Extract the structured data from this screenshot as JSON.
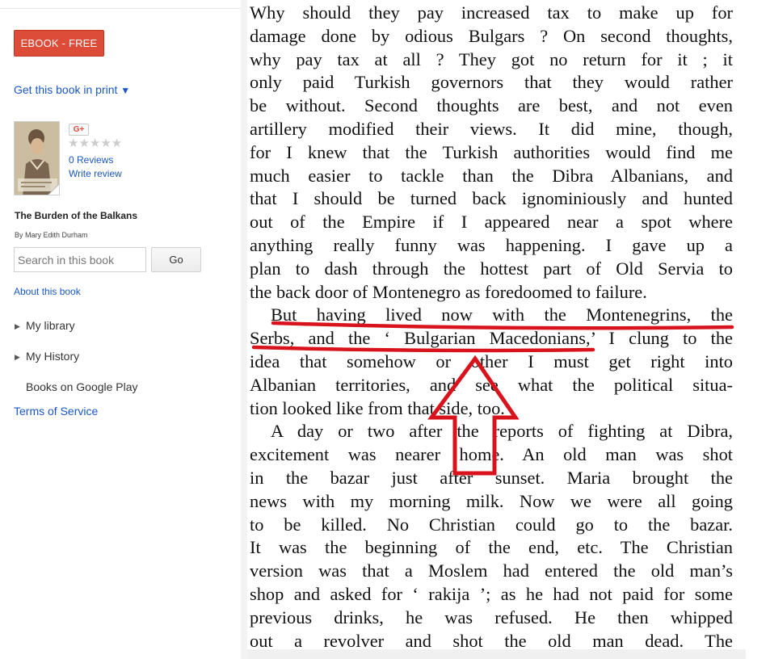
{
  "sidebar": {
    "ebook_button": "EBOOK - FREE",
    "print_link": "Get this book in print",
    "gplus_label": "G+",
    "stars": "★★★★★",
    "reviews_count": "0 Reviews",
    "write_review": "Write review",
    "book_title": "The Burden of the Balkans",
    "author": "By Mary Edith Durham",
    "search_placeholder": "Search in this book",
    "go_button": "Go",
    "about": "About this book",
    "nav": [
      "My library",
      "My History",
      "Books on Google Play"
    ],
    "terms": "Terms of Service"
  },
  "page": {
    "lines": [
      "Why should they pay increased tax to make up for",
      "damage done by odious Bulgars ?  On second thoughts,",
      "why pay tax at all ?  They got no return for it ; it",
      "only paid Turkish governors that they would rather",
      "be without.  Second thoughts are best, and not even",
      "artillery modified their views.  It did mine, though,",
      "for I knew that the Turkish authorities would find me",
      "much easier to tackle than the Dibra Albanians, and",
      "that I should be turned back ignominiously and hunted",
      "out of the Empire if I appeared near a spot where",
      "anything really funny was happening.  I gave up a",
      "plan to dash through the hottest part of Old Servia to",
      "the back door of Montenegro as foredoomed to failure.",
      "But having lived now with the Montenegrins, the",
      "Serbs, and the ‘ Bulgarian Macedonians,’ I clung to the",
      "idea that somehow or other I must get right into",
      "Albanian territories, and see what the political situa-",
      "tion looked like from that side, too.",
      "A day or two after the reports of fighting at Dibra,",
      "excitement was nearer home.  An old man was shot",
      "in the bazar just after sunset.  Maria brought the",
      "news with my morning milk.  Now we were all going",
      "to be killed.  No Christian could go to the bazar.",
      "It was the beginning of the end, etc.  The Christian",
      "version was that a Moslem had entered the old man’s",
      "shop and asked for ‘ rakija ’;  as he had not paid for some",
      "previous drinks, he was refused.  He then whipped",
      "out a revolver and shot the old man dead.  The"
    ]
  },
  "annotation": {
    "color": "#d9131b"
  }
}
